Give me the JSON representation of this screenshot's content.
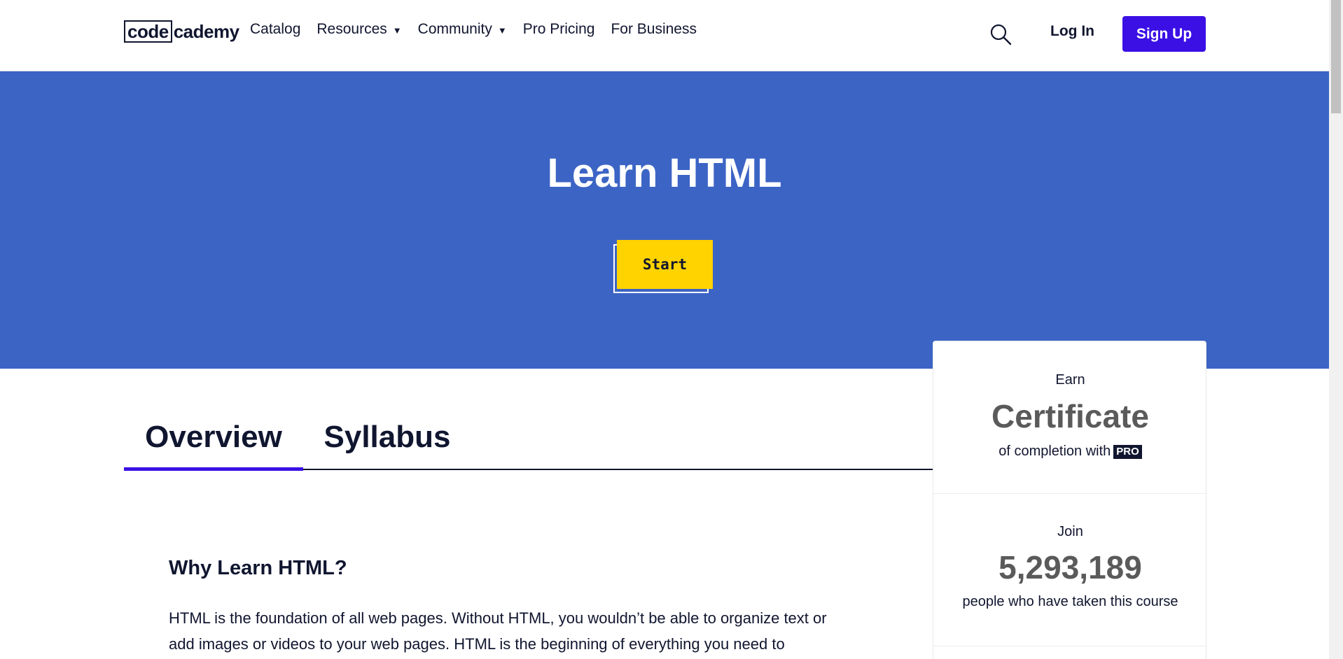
{
  "nav": {
    "logo_boxed": "code",
    "logo_rest": "cademy",
    "links": [
      {
        "label": "Catalog",
        "has_caret": false
      },
      {
        "label": "Resources",
        "has_caret": true
      },
      {
        "label": "Community",
        "has_caret": true
      },
      {
        "label": "Pro Pricing",
        "has_caret": false
      },
      {
        "label": "For Business",
        "has_caret": false
      }
    ],
    "caret_glyph": "▼",
    "search_icon": "search-icon",
    "login_label": "Log In",
    "signup_label": "Sign Up"
  },
  "hero": {
    "title": "Learn HTML",
    "start_label": "Start",
    "bg_color": "#3c64c5",
    "button_color": "#ffd300"
  },
  "tabs": {
    "overview_label": "Overview",
    "syllabus_label": "Syllabus",
    "active": "Overview",
    "accent_color": "#3a10e5"
  },
  "content": {
    "why_title": "Why Learn HTML?",
    "why_body": "HTML is the foundation of all web pages. Without HTML, you wouldn’t be able to organize text or add images or videos to your web pages. HTML is the beginning of everything you need to"
  },
  "card": {
    "earn_label": "Earn",
    "certificate_label": "Certificate",
    "completion_text": "of completion with",
    "pro_badge": "PRO",
    "join_label": "Join",
    "learner_count": "5,293,189",
    "learners_text": "people who have taken this course"
  }
}
